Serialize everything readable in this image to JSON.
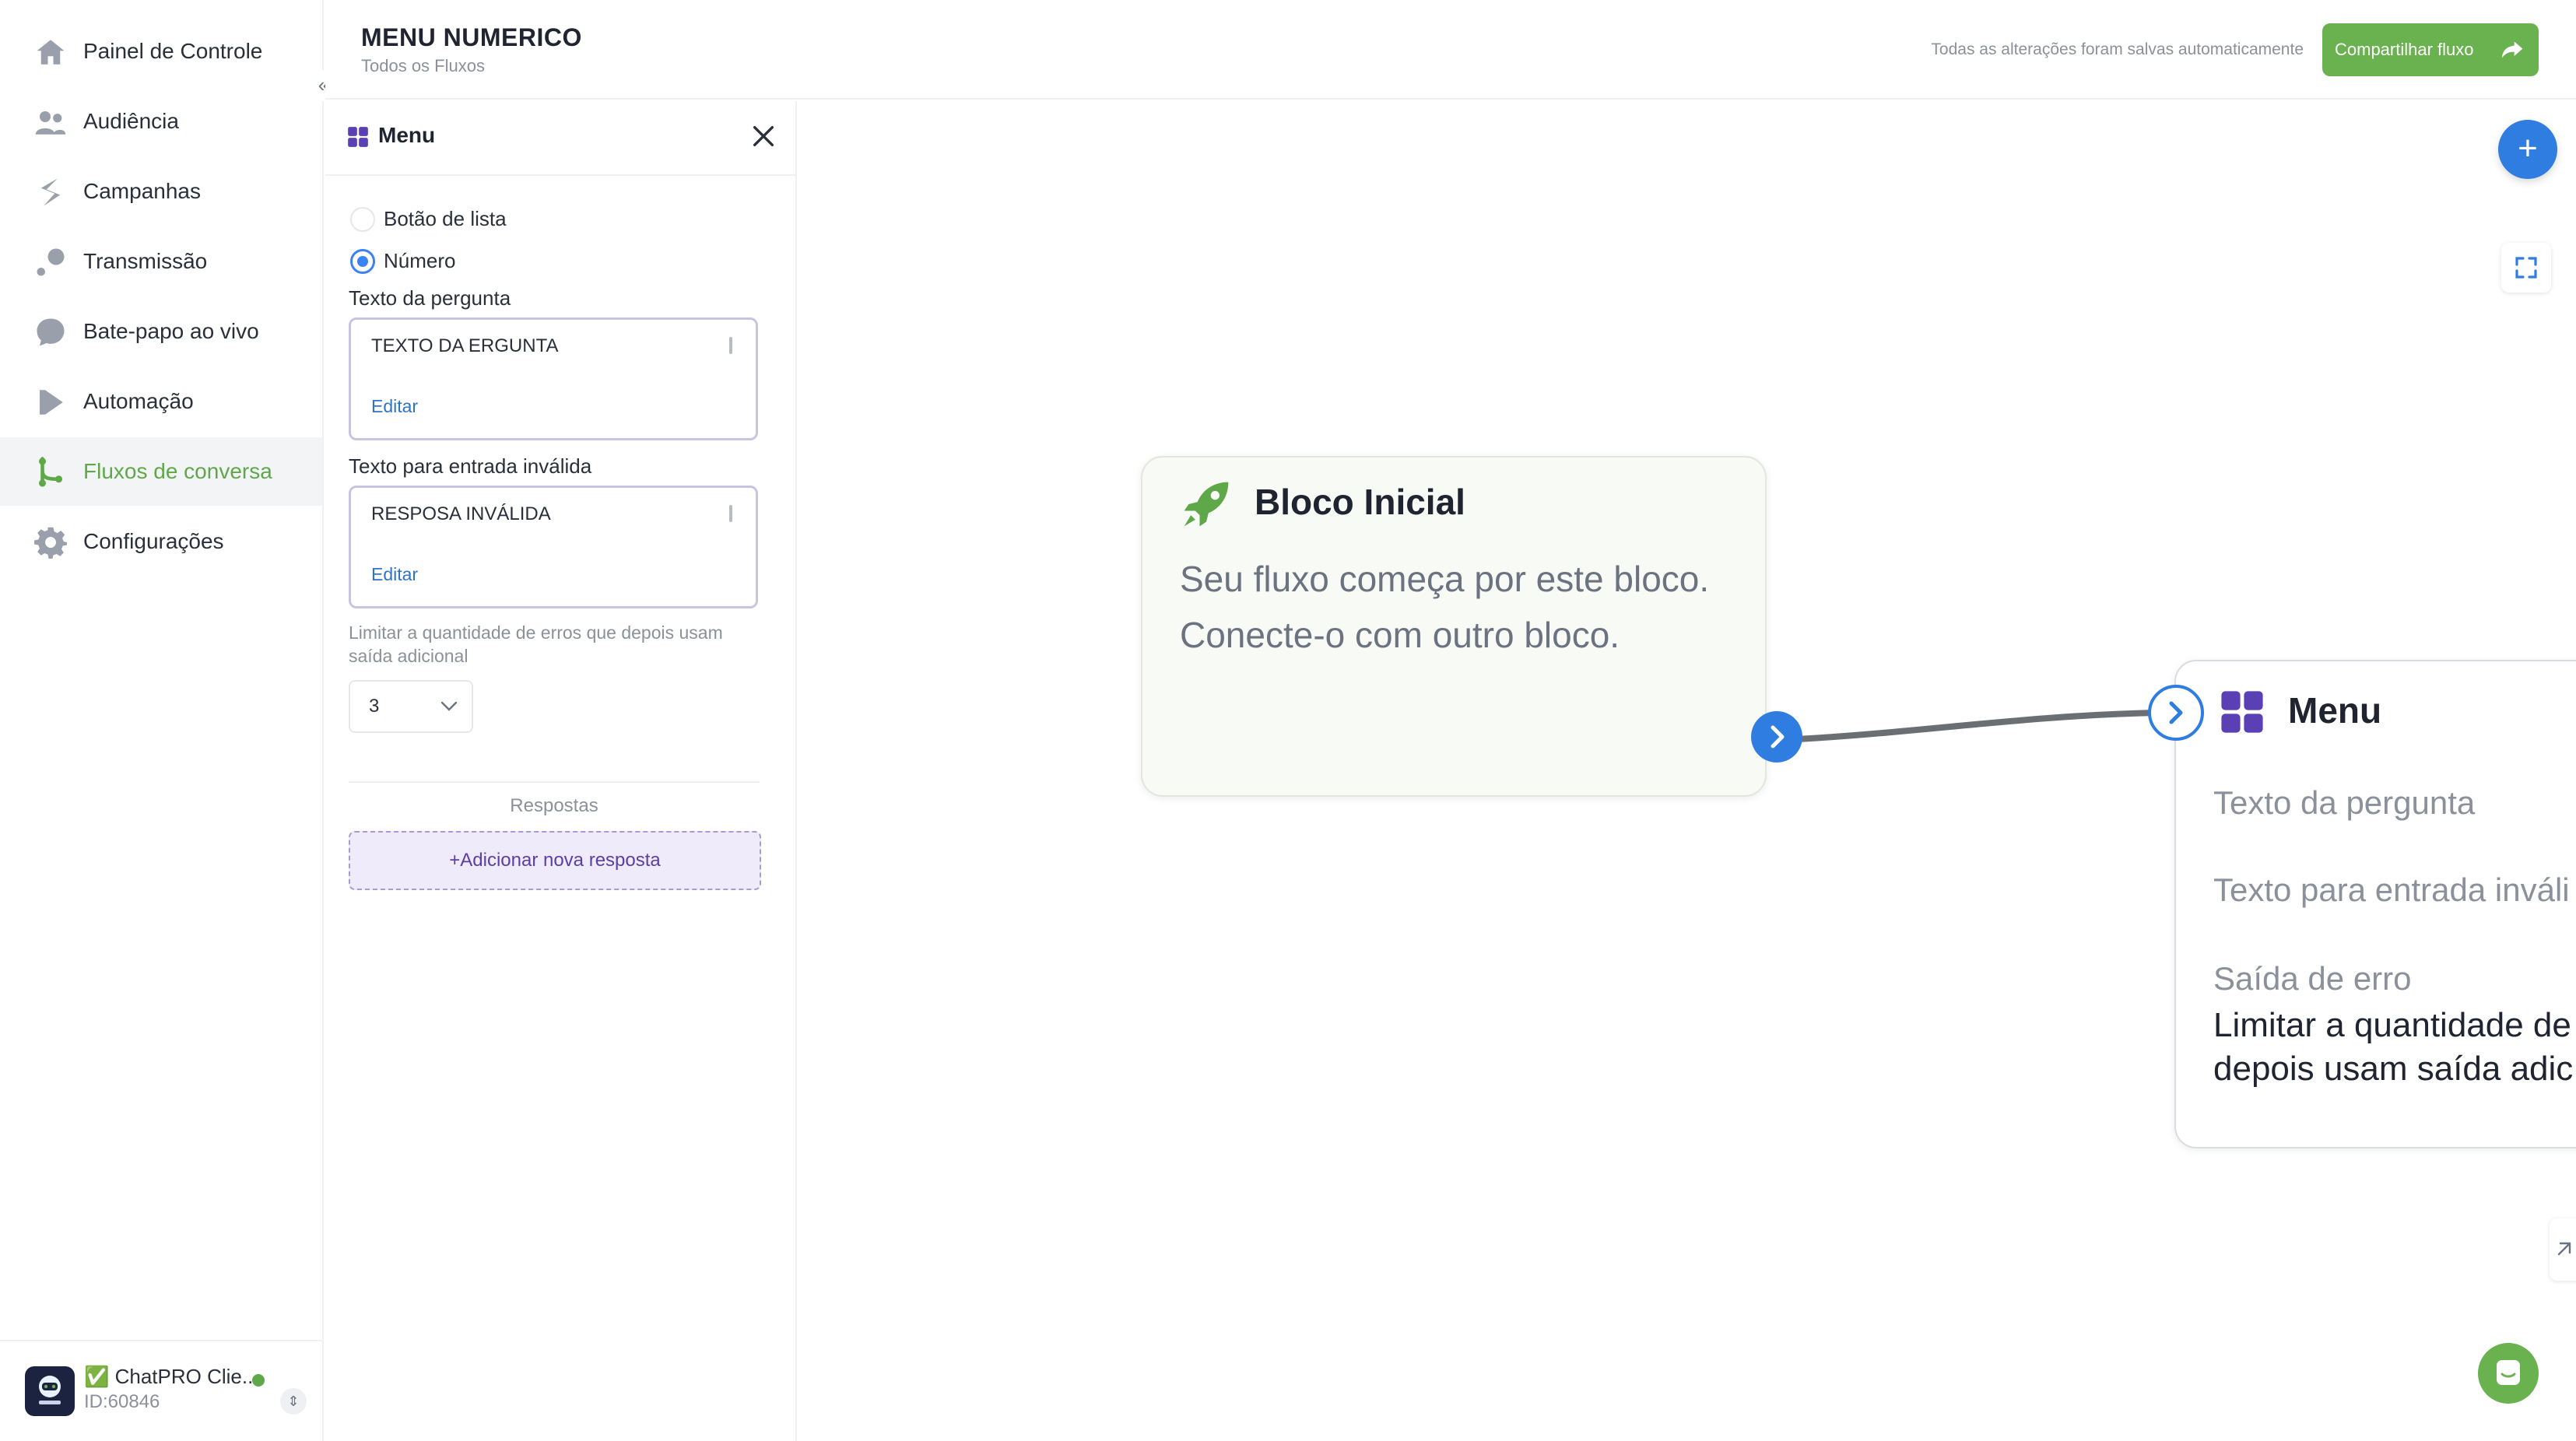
{
  "sidebar": {
    "items": [
      {
        "label": "Painel de Controle",
        "icon": "home-icon"
      },
      {
        "label": "Audiência",
        "icon": "users-icon"
      },
      {
        "label": "Campanhas",
        "icon": "campaign-icon"
      },
      {
        "label": "Transmissão",
        "icon": "broadcast-icon"
      },
      {
        "label": "Bate-papo ao vivo",
        "icon": "chat-bubble-icon"
      },
      {
        "label": "Automação",
        "icon": "automation-icon"
      },
      {
        "label": "Fluxos de conversa",
        "icon": "flow-icon",
        "active": true
      },
      {
        "label": "Configurações",
        "icon": "gear-icon"
      }
    ],
    "collapse_icon": "double-chevron-left-icon",
    "account": {
      "name": "✅ ChatPRO Clie...",
      "id": "ID:60846",
      "status_color": "#5fa84a"
    }
  },
  "header": {
    "title": "MENU NUMERICO",
    "breadcrumb": "Todos os Fluxos",
    "save_status": "Todas as alterações foram salvas automaticamente",
    "share_label": "Compartilhar fluxo"
  },
  "panel": {
    "title": "Menu",
    "options": [
      {
        "label": "Botão de lista",
        "checked": false
      },
      {
        "label": "Número",
        "checked": true
      }
    ],
    "question": {
      "label": "Texto da pergunta",
      "value": "TEXTO DA ERGUNTA",
      "edit_label": "Editar"
    },
    "invalid": {
      "label": "Texto para entrada inválida",
      "value": "RESPOSA INVÁLIDA",
      "edit_label": "Editar"
    },
    "limit_note": "Limitar a quantidade de erros que depois usam saída adicional",
    "limit_value": "3",
    "answers_label": "Respostas",
    "add_answer_label": "+Adicionar nova resposta"
  },
  "canvas": {
    "start_block": {
      "title": "Bloco Inicial",
      "description": "Seu fluxo começa por este bloco. Conecte-o com outro bloco."
    },
    "menu_block": {
      "title": "Menu",
      "question_label": "Texto da pergunta",
      "invalid_label": "Texto para entrada inváli",
      "error_label": "Saída de erro",
      "error_desc_line1": "Limitar a quantidade de",
      "error_desc_line2": "depois usam saída adic"
    }
  },
  "colors": {
    "brand_green": "#6ab150",
    "accent_blue": "#2f7de1",
    "menu_purple": "#5b3fb5"
  }
}
